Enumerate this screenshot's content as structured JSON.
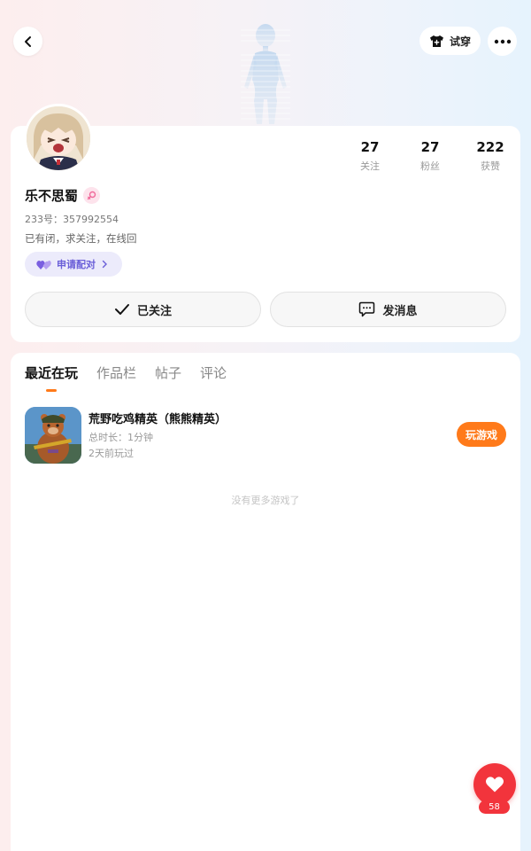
{
  "header": {
    "back_icon": "chevron-left-icon",
    "tryon_label": "试穿",
    "tryon_icon": "tshirt-icon",
    "more_icon": "more-dots-icon"
  },
  "profile": {
    "username": "乐不思蜀",
    "gender_icon": "female-symbol-icon",
    "uid": "233号：357992554",
    "bio": "已有闭，求关注，在线回",
    "pair_label": "申请配对",
    "stats": [
      {
        "value": "27",
        "label": "关注"
      },
      {
        "value": "27",
        "label": "粉丝"
      },
      {
        "value": "222",
        "label": "获赞"
      }
    ],
    "follow_label": "已关注",
    "message_label": "发消息"
  },
  "tabs": [
    "最近在玩",
    "作品栏",
    "帖子",
    "评论"
  ],
  "active_tab": "最近在玩",
  "games": [
    {
      "title": "荒野吃鸡精英（熊熊精英）",
      "duration": "总时长：1分钟",
      "last_played": "2天前玩过",
      "action_label": "玩游戏"
    }
  ],
  "no_more_text": "没有更多游戏了",
  "like": {
    "count": "58",
    "icon": "heart-icon"
  },
  "colors": {
    "accent_orange": "#ff7a1a",
    "like_red": "#f2343c",
    "pair_purple": "#6a5fd8"
  }
}
